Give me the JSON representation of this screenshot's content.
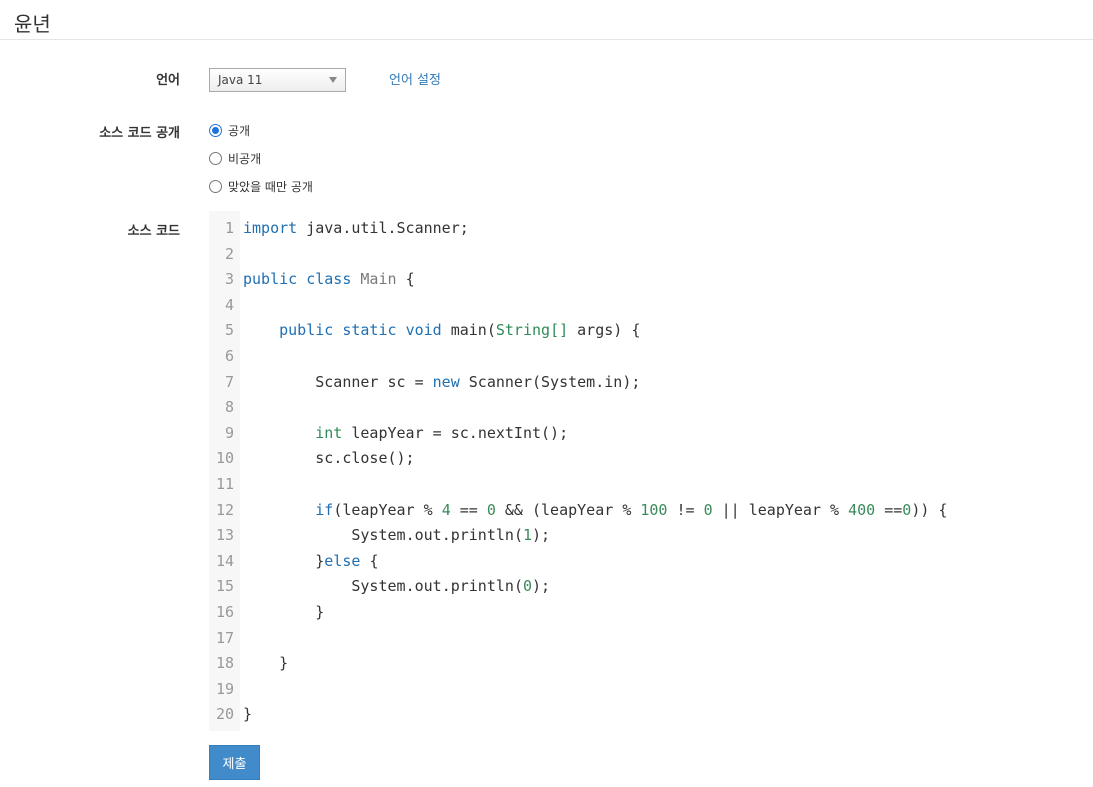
{
  "page": {
    "title": "윤년"
  },
  "form": {
    "language_label": "언어",
    "language_selected": "Java 11",
    "language_settings_link": "언어 설정",
    "visibility_label": "소스 코드 공개",
    "visibility_options": [
      {
        "label": "공개",
        "checked": true
      },
      {
        "label": "비공개",
        "checked": false
      },
      {
        "label": "맞았을 때만 공개",
        "checked": false
      }
    ],
    "source_label": "소스 코드",
    "submit_label": "제출"
  },
  "editor": {
    "lines": [
      "import java.util.Scanner;",
      "",
      "public class Main {",
      "",
      "    public static void main(String[] args) {",
      "",
      "        Scanner sc = new Scanner(System.in);",
      "",
      "        int leapYear = sc.nextInt();",
      "        sc.close();",
      "",
      "        if(leapYear % 4 == 0 && (leapYear % 100 != 0 || leapYear % 400 ==0)) {",
      "            System.out.println(1);",
      "        }else {",
      "            System.out.println(0);",
      "        }",
      "",
      "    }",
      "",
      "}"
    ]
  },
  "colors": {
    "keyword": "#1f6fb2",
    "type": "#2e8b57",
    "classname": "#7a7a7a",
    "number": "#3a8a5a",
    "text": "#333333",
    "accent": "#428bca"
  }
}
